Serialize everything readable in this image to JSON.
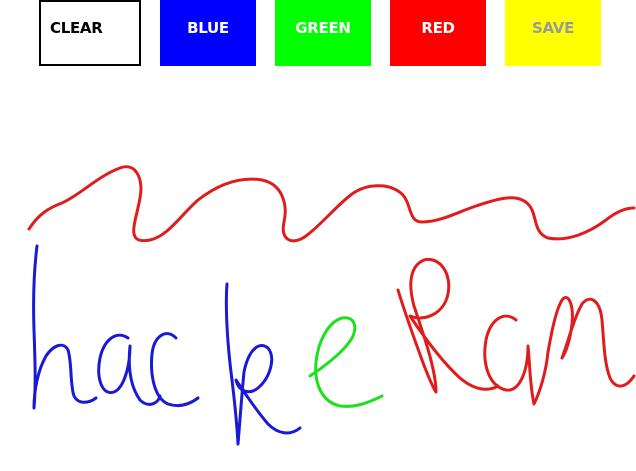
{
  "toolbar": {
    "clear_label": "CLEAR",
    "blue_label": "BLUE",
    "green_label": "GREEN",
    "red_label": "RED",
    "save_label": "SAVE"
  },
  "colors": {
    "blue": "#0000ff",
    "green": "#00ff00",
    "red": "#ff0000",
    "yellow": "#ffff00",
    "ink_red": "#e01c1c",
    "ink_blue": "#1a1ad6",
    "ink_green": "#1ee01e"
  },
  "drawing": {
    "handwriting": "hacker Ram"
  }
}
